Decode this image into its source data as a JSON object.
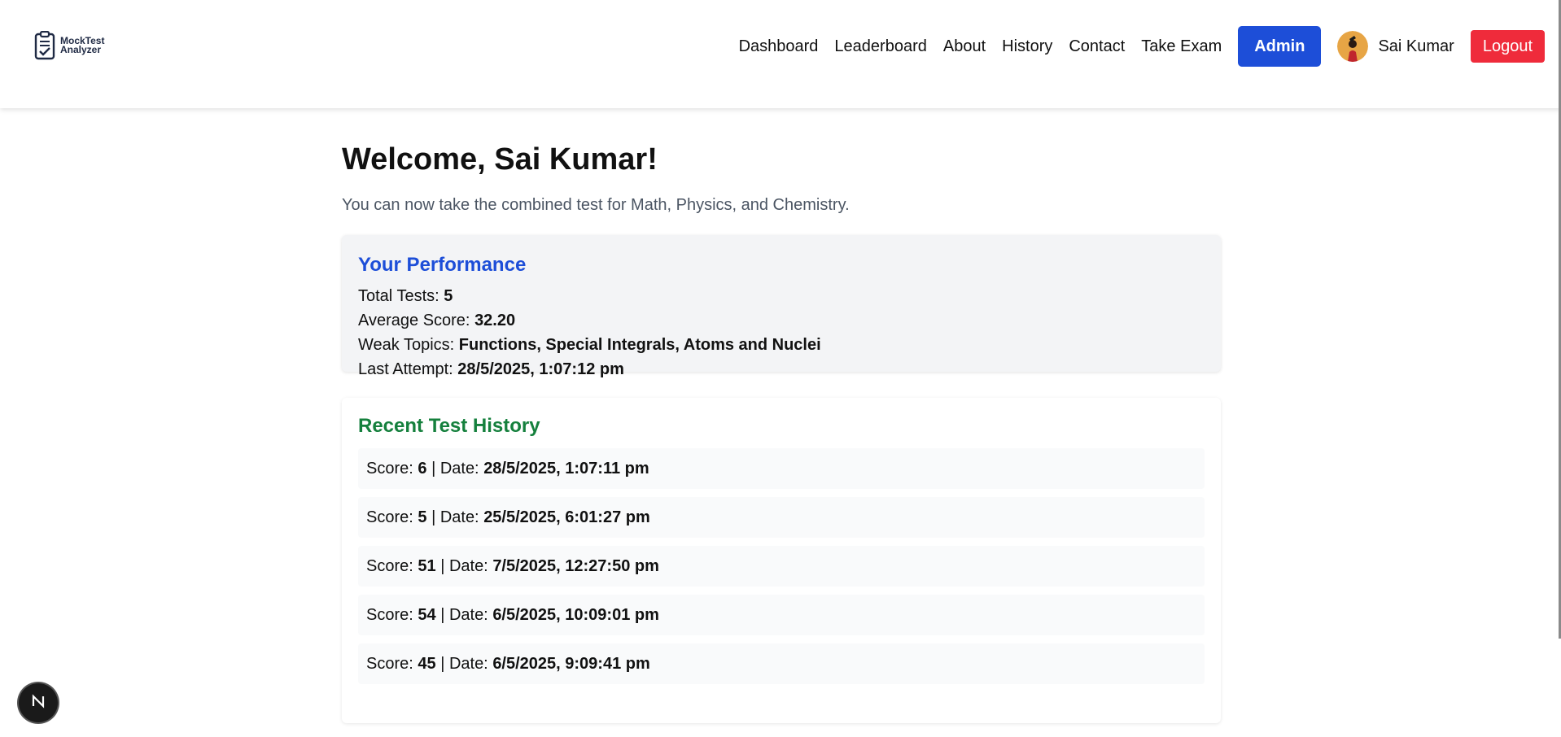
{
  "header": {
    "logo_line1": "MockTest",
    "logo_line2": "Analyzer",
    "nav": [
      "Dashboard",
      "Leaderboard",
      "About",
      "History",
      "Contact",
      "Take Exam"
    ],
    "admin_label": "Admin",
    "user_name": "Sai Kumar",
    "logout_label": "Logout"
  },
  "main": {
    "title": "Welcome, Sai Kumar!",
    "subtitle": "You can now take the combined test for Math, Physics, and Chemistry."
  },
  "performance": {
    "title": "Your Performance",
    "total_tests_label": "Total Tests:",
    "total_tests": "5",
    "avg_label": "Average Score:",
    "avg": "32.20",
    "weak_label": "Weak Topics:",
    "weak": "Functions, Special Integrals, Atoms and Nuclei",
    "last_label": "Last Attempt:",
    "last": "28/5/2025, 1:07:12 pm"
  },
  "history": {
    "title": "Recent Test History",
    "score_label": "Score:",
    "sep": "| Date:",
    "items": [
      {
        "score": "6",
        "date": "28/5/2025, 1:07:11 pm"
      },
      {
        "score": "5",
        "date": "25/5/2025, 6:01:27 pm"
      },
      {
        "score": "51",
        "date": "7/5/2025, 12:27:50 pm"
      },
      {
        "score": "54",
        "date": "6/5/2025, 10:09:01 pm"
      },
      {
        "score": "45",
        "date": "6/5/2025, 9:09:41 pm"
      }
    ]
  },
  "icons": {
    "logo": "clipboard-check-icon",
    "dev_badge": "next-logo-icon"
  },
  "colors": {
    "admin": "#1d4ed8",
    "logout": "#ef2b3b",
    "performance_title": "#1d4ed8",
    "history_title": "#15803d"
  }
}
